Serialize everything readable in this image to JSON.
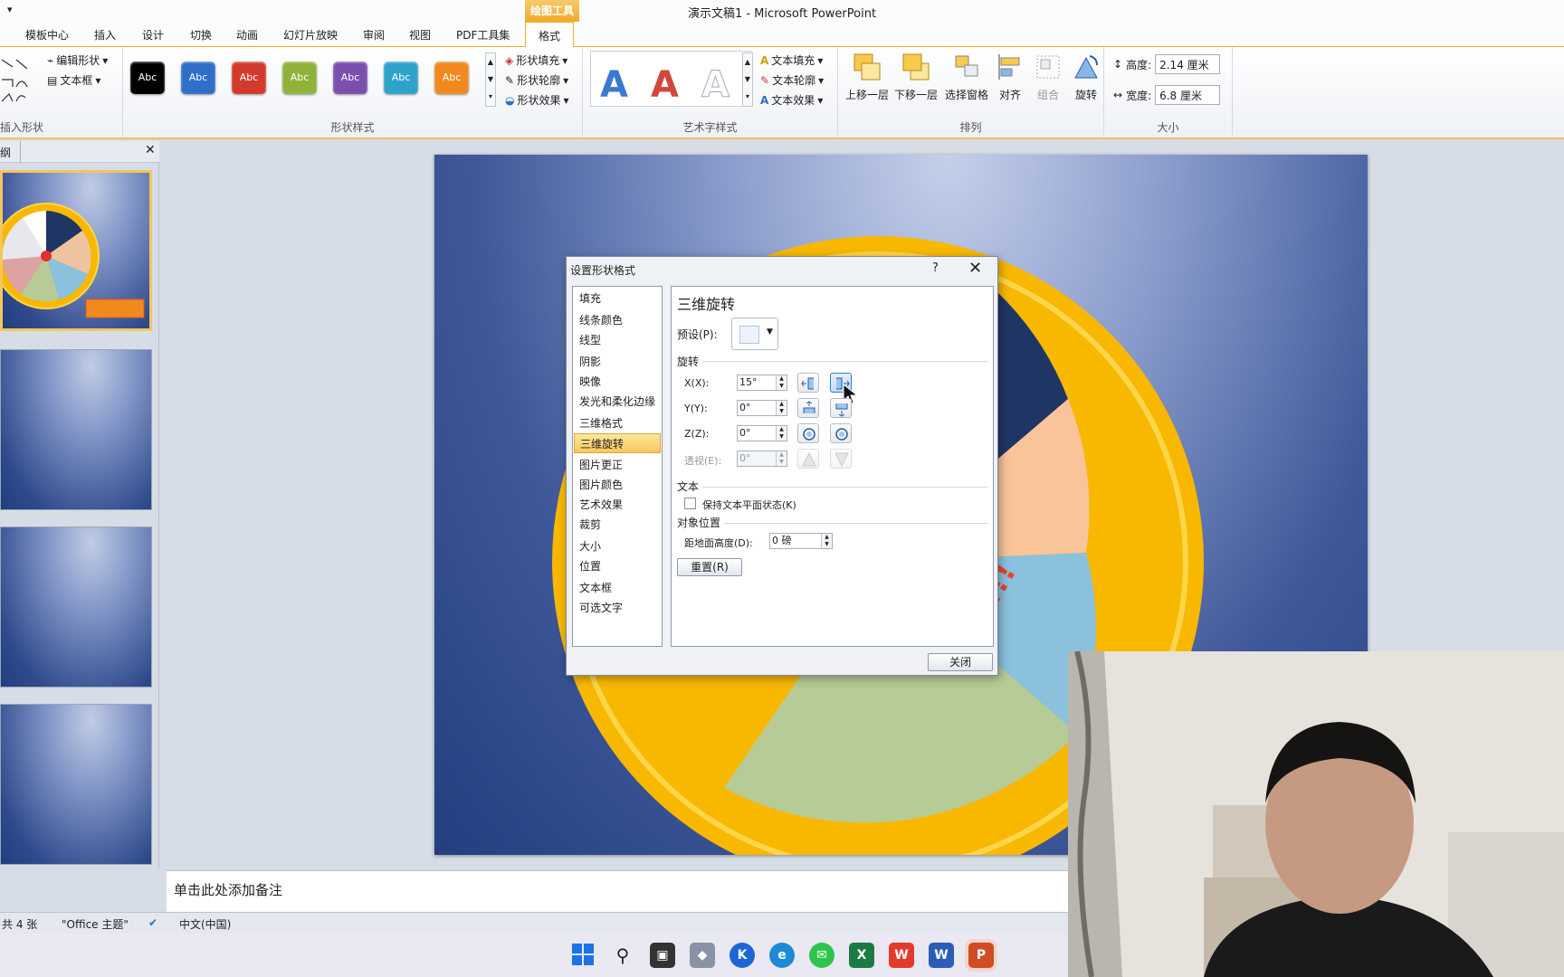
{
  "window": {
    "title": "演示文稿1 - Microsoft PowerPoint",
    "context_tab_header": "绘图工具"
  },
  "tabs": [
    {
      "label": "模板中心"
    },
    {
      "label": "插入"
    },
    {
      "label": "设计"
    },
    {
      "label": "切换"
    },
    {
      "label": "动画"
    },
    {
      "label": "幻灯片放映"
    },
    {
      "label": "审阅"
    },
    {
      "label": "视图"
    },
    {
      "label": "PDF工具集"
    },
    {
      "label": "格式"
    }
  ],
  "ribbon": {
    "insert_shapes": {
      "label": "插入形状",
      "edit_shape": "编辑形状",
      "text_box": "文本框"
    },
    "shape_styles": {
      "label": "形状样式",
      "swatch_text": "Abc",
      "swatches": [
        "#000000",
        "#2f6fc9",
        "#d23b2c",
        "#8fb23b",
        "#7b4fae",
        "#2ea3c9",
        "#f08a1f"
      ],
      "fill": "形状填充",
      "outline": "形状轮廓",
      "effects": "形状效果"
    },
    "wordart": {
      "label": "艺术字样式",
      "letter": "A",
      "text_fill": "文本填充",
      "text_outline": "文本轮廓",
      "text_effects": "文本效果"
    },
    "arrange": {
      "label": "排列",
      "bring_forward": "上移一层",
      "send_backward": "下移一层",
      "selection_pane": "选择窗格",
      "align": "对齐",
      "group": "组合",
      "rotate": "旋转"
    },
    "size": {
      "label": "大小",
      "height_label": "高度:",
      "height_value": "2.14 厘米",
      "width_label": "宽度:",
      "width_value": "6.8 厘米"
    }
  },
  "panel": {
    "header_fragment": "纲"
  },
  "notes": {
    "placeholder": "单击此处添加备注"
  },
  "status": {
    "slides": "共 4 张",
    "theme": "\"Office 主题\"",
    "language": "中文(中国)"
  },
  "dialog": {
    "title": "设置形状格式",
    "help": "?",
    "nav": [
      "填充",
      "线条颜色",
      "线型",
      "阴影",
      "映像",
      "发光和柔化边缘",
      "三维格式",
      "三维旋转",
      "图片更正",
      "图片颜色",
      "艺术效果",
      "裁剪",
      "大小",
      "位置",
      "文本框",
      "可选文字"
    ],
    "selected_nav": "三维旋转",
    "heading": "三维旋转",
    "preset_label": "预设(P):",
    "rotation_section": "旋转",
    "x_label": "X(X):",
    "x_value": "15°",
    "y_label": "Y(Y):",
    "y_value": "0°",
    "z_label": "Z(Z):",
    "z_value": "0°",
    "perspective_label": "透视(E):",
    "perspective_value": "0°",
    "text_section": "文本",
    "keep_text_flat": "保持文本平面状态(K)",
    "position_section": "对象位置",
    "distance_label": "距地面高度(D):",
    "distance_value": "0 磅",
    "reset": "重置(R)",
    "close": "关闭"
  },
  "taskbar": {
    "apps": [
      "start",
      "search",
      "task-view",
      "app",
      "kugou",
      "edge",
      "wechat",
      "excel",
      "wps",
      "word",
      "powerpoint"
    ]
  }
}
